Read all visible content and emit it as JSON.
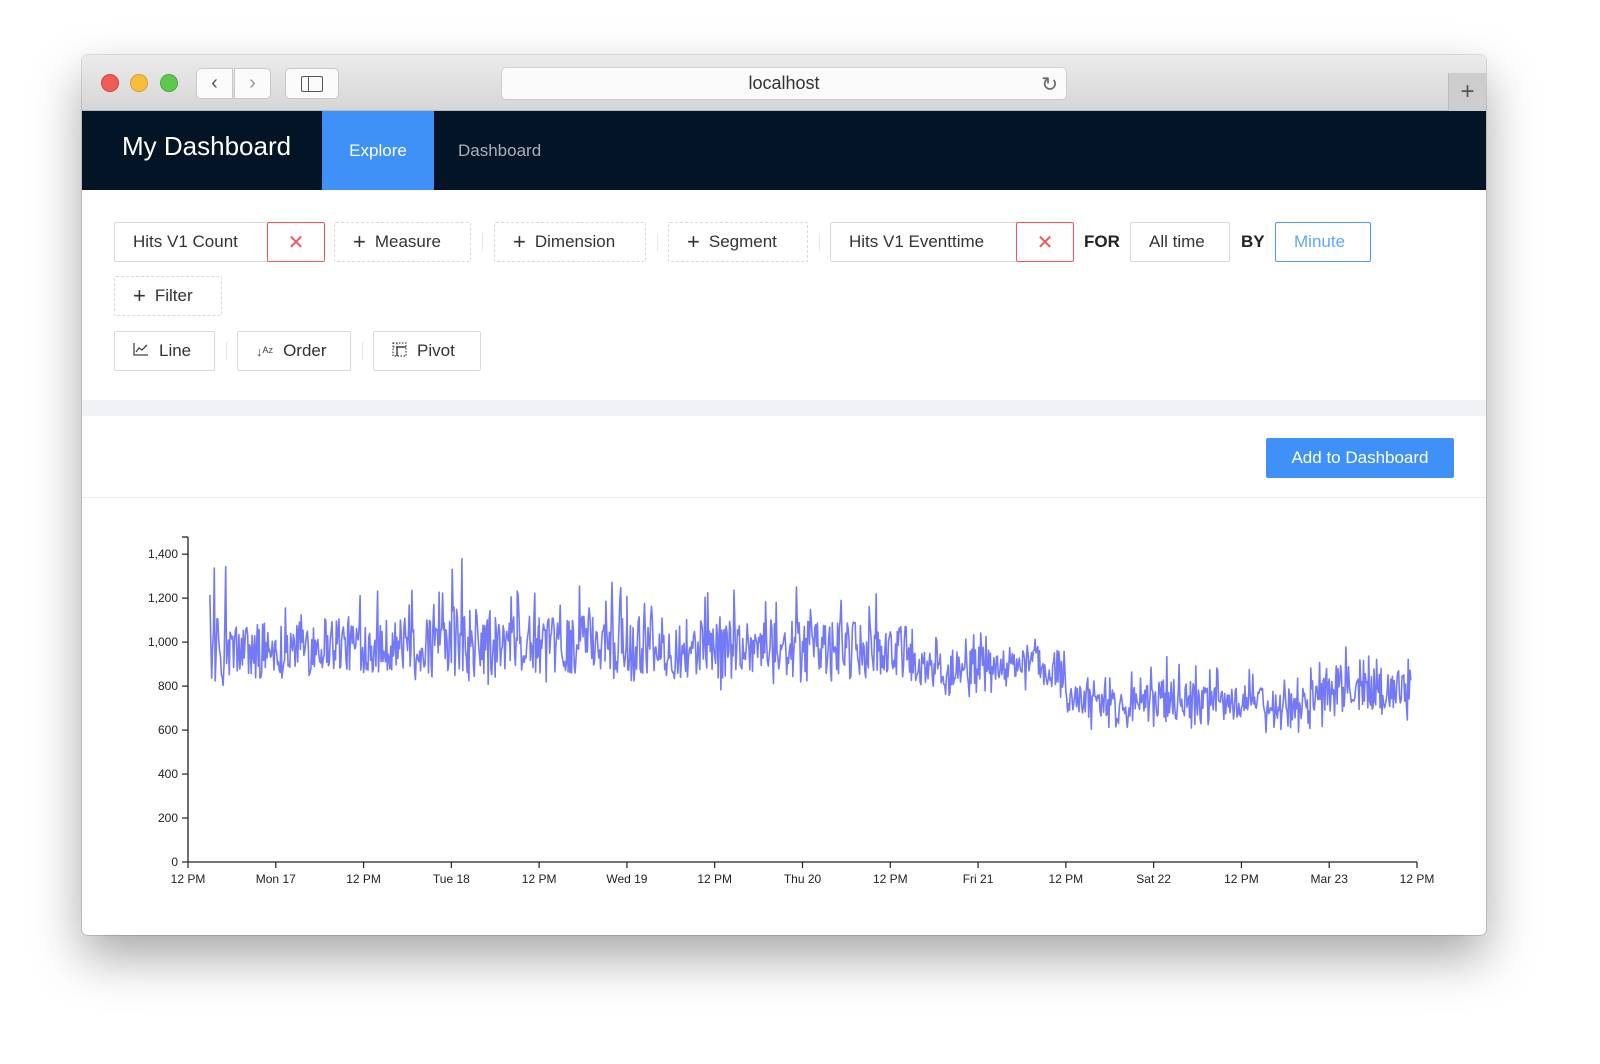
{
  "browser": {
    "address": "localhost",
    "back_icon": "chevron-left-icon",
    "forward_icon": "chevron-right-icon",
    "sidebar_icon": "sidebar-icon",
    "reload_icon": "reload-icon",
    "new_tab_icon": "plus-icon"
  },
  "navbar": {
    "brand": "My Dashboard",
    "tabs": [
      {
        "label": "Explore",
        "active": true
      },
      {
        "label": "Dashboard",
        "active": false
      }
    ]
  },
  "query": {
    "measure_chip": "Hits V1 Count",
    "add_measure": "Measure",
    "add_dimension": "Dimension",
    "add_segment": "Segment",
    "time_dimension_chip": "Hits V1 Eventtime",
    "for_label": "FOR",
    "date_range": "All time",
    "by_label": "BY",
    "granularity": "Minute",
    "add_filter": "Filter",
    "remove_glyph": "✕",
    "plus_glyph": "+"
  },
  "toolbar": {
    "chart_type": "Line",
    "order": "Order",
    "pivot": "Pivot"
  },
  "actions": {
    "add_to_dashboard": "Add to Dashboard"
  },
  "colors": {
    "nav_bg": "#031427",
    "accent": "#3f90f7",
    "danger": "#f0575a",
    "series": "#7479f5"
  },
  "chart_data": {
    "type": "line",
    "title": "",
    "xlabel": "",
    "ylabel": "",
    "ylim": [
      0,
      1460
    ],
    "yticks": [
      0,
      200,
      400,
      600,
      800,
      1000,
      1200,
      1400
    ],
    "ytick_labels": [
      "0",
      "200",
      "400",
      "600",
      "800",
      "1,000",
      "1,200",
      "1,400"
    ],
    "x_range_hours": [
      0,
      168
    ],
    "xtick_hours": [
      0,
      12,
      24,
      36,
      48,
      60,
      72,
      84,
      96,
      108,
      120,
      132,
      144,
      156,
      168
    ],
    "xtick_labels": [
      "12 PM",
      "Mon 17",
      "12 PM",
      "Tue 18",
      "12 PM",
      "Wed 19",
      "12 PM",
      "Thu 20",
      "12 PM",
      "Fri 21",
      "12 PM",
      "Sat 22",
      "12 PM",
      "Mar 23",
      "12 PM"
    ],
    "grid": false,
    "legend": "none",
    "series": [
      {
        "name": "Hits V1 Count",
        "granularity": "minute",
        "note": "dense per-minute series summarized as 3-hour buckets [start_hour, min, mean, max]",
        "buckets": [
          [
            3,
            800,
            960,
            1380
          ],
          [
            6,
            790,
            960,
            1250
          ],
          [
            9,
            800,
            970,
            1290
          ],
          [
            12,
            820,
            980,
            1220
          ],
          [
            15,
            790,
            990,
            1310
          ],
          [
            18,
            810,
            1000,
            1300
          ],
          [
            21,
            800,
            990,
            1260
          ],
          [
            24,
            830,
            990,
            1300
          ],
          [
            27,
            790,
            990,
            1230
          ],
          [
            30,
            820,
            980,
            1280
          ],
          [
            33,
            800,
            985,
            1260
          ],
          [
            36,
            830,
            990,
            1460
          ],
          [
            39,
            800,
            1000,
            1400
          ],
          [
            42,
            810,
            980,
            1300
          ],
          [
            45,
            790,
            990,
            1270
          ],
          [
            48,
            780,
            985,
            1240
          ],
          [
            51,
            820,
            990,
            1310
          ],
          [
            54,
            800,
            1000,
            1250
          ],
          [
            57,
            820,
            995,
            1300
          ],
          [
            60,
            790,
            990,
            1280
          ],
          [
            63,
            810,
            985,
            1270
          ],
          [
            66,
            820,
            990,
            1310
          ],
          [
            69,
            830,
            985,
            1260
          ],
          [
            72,
            780,
            975,
            1290
          ],
          [
            75,
            810,
            985,
            1250
          ],
          [
            78,
            800,
            980,
            1270
          ],
          [
            81,
            800,
            975,
            1290
          ],
          [
            84,
            820,
            980,
            1240
          ],
          [
            87,
            810,
            970,
            1300
          ],
          [
            90,
            790,
            965,
            1250
          ],
          [
            93,
            790,
            960,
            1220
          ],
          [
            96,
            780,
            950,
            1250
          ],
          [
            99,
            760,
            880,
            1060
          ],
          [
            102,
            740,
            880,
            1050
          ],
          [
            105,
            750,
            890,
            1040
          ],
          [
            108,
            740,
            900,
            1050
          ],
          [
            111,
            760,
            900,
            1050
          ],
          [
            114,
            740,
            900,
            1060
          ],
          [
            117,
            720,
            880,
            1040
          ],
          [
            120,
            600,
            740,
            870
          ],
          [
            123,
            590,
            720,
            850
          ],
          [
            126,
            600,
            725,
            880
          ],
          [
            129,
            580,
            720,
            890
          ],
          [
            132,
            600,
            740,
            940
          ],
          [
            135,
            590,
            730,
            920
          ],
          [
            138,
            600,
            730,
            890
          ],
          [
            141,
            600,
            720,
            870
          ],
          [
            144,
            600,
            725,
            880
          ],
          [
            147,
            580,
            710,
            840
          ],
          [
            150,
            590,
            720,
            860
          ],
          [
            153,
            600,
            770,
            910
          ],
          [
            156,
            620,
            780,
            1040
          ],
          [
            159,
            620,
            780,
            940
          ],
          [
            162,
            640,
            780,
            930
          ],
          [
            165,
            640,
            790,
            950
          ]
        ]
      }
    ]
  }
}
